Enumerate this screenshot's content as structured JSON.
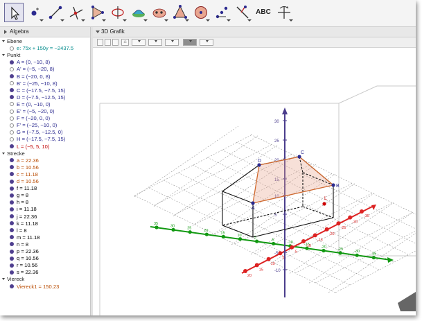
{
  "tools": [
    "move-tool",
    "point-tool",
    "segment-tool",
    "perpendicular-tool",
    "polygon-tool",
    "rotate-around-tool",
    "intersect-surfaces-tool",
    "pyramid-tool",
    "sphere-tool",
    "cube-tool",
    "reflect-tool",
    "line-tool",
    "text-tool",
    "rotate-view-tool"
  ],
  "text_tool_label": "ABC",
  "algebra": {
    "title": "Algebra",
    "categories": [
      "Ebene",
      "Punkt",
      "Strecke",
      "Viereck"
    ],
    "rows": [
      {
        "label": "e: 75x + 150y = −2437.5",
        "color": "#008b8b",
        "visible": false,
        "category_row": 0
      },
      {
        "label": "A = (0, −10, 8)",
        "color": "#2b2a8f",
        "visible": true
      },
      {
        "label": "A' = (−5, −20, 8)",
        "color": "#2b2a8f",
        "visible": false
      },
      {
        "label": "B = (−20, 0, 8)",
        "color": "#2b2a8f",
        "visible": true
      },
      {
        "label": "B' = (−25, −10, 8)",
        "color": "#2b2a8f",
        "visible": false
      },
      {
        "label": "C = (−17.5, −7.5, 15)",
        "color": "#2b2a8f",
        "visible": true
      },
      {
        "label": "D = (−7.5, −12.5, 15)",
        "color": "#2b2a8f",
        "visible": true
      },
      {
        "label": "E = (0, −10, 0)",
        "color": "#2b2a8f",
        "visible": false
      },
      {
        "label": "E' = (−5, −20, 0)",
        "color": "#2b2a8f",
        "visible": false
      },
      {
        "label": "F = (−20, 0, 0)",
        "color": "#2b2a8f",
        "visible": false
      },
      {
        "label": "F' = (−25, −10, 0)",
        "color": "#2b2a8f",
        "visible": false
      },
      {
        "label": "G = (−7.5, −12.5, 0)",
        "color": "#2b2a8f",
        "visible": false
      },
      {
        "label": "H = (−17.5, −7.5, 15)",
        "color": "#2b2a8f",
        "visible": false
      },
      {
        "label": "L = (−5, 5, 10)",
        "color": "#c00000",
        "visible": true
      },
      {
        "label": "a = 22.36",
        "color": "#b84a00",
        "visible": true
      },
      {
        "label": "b = 10.56",
        "color": "#b84a00",
        "visible": true
      },
      {
        "label": "c = 11.18",
        "color": "#b84a00",
        "visible": true
      },
      {
        "label": "d = 10.56",
        "color": "#b84a00",
        "visible": true
      },
      {
        "label": "f = 11.18",
        "color": "#000000",
        "visible": true
      },
      {
        "label": "g = 8",
        "color": "#000000",
        "visible": true
      },
      {
        "label": "h = 8",
        "color": "#000000",
        "visible": true
      },
      {
        "label": "i = 11.18",
        "color": "#000000",
        "visible": true
      },
      {
        "label": "j = 22.36",
        "color": "#000000",
        "visible": true
      },
      {
        "label": "k = 11.18",
        "color": "#000000",
        "visible": true
      },
      {
        "label": "l = 8",
        "color": "#000000",
        "visible": true
      },
      {
        "label": "m = 11.18",
        "color": "#000000",
        "visible": true
      },
      {
        "label": "n = 8",
        "color": "#000000",
        "visible": true
      },
      {
        "label": "p = 22.36",
        "color": "#000000",
        "visible": true
      },
      {
        "label": "q = 10.56",
        "color": "#000000",
        "visible": true
      },
      {
        "label": "r = 10.56",
        "color": "#000000",
        "visible": true
      },
      {
        "label": "s = 22.36",
        "color": "#000000",
        "visible": true
      },
      {
        "label": "Viereck1 = 150.23",
        "color": "#b84a00",
        "visible": true
      }
    ]
  },
  "graphics": {
    "title": "3D Grafik",
    "home_icon": "⌂",
    "point_labels": {
      "A": "A",
      "B": "B",
      "C": "C",
      "D": "D",
      "L": "L"
    },
    "z_ticks": [
      "30",
      "25",
      "20",
      "15",
      "10",
      "5",
      "-5",
      "-10"
    ],
    "x_ticks": [
      "35",
      "30",
      "25",
      "20",
      "15",
      "10",
      "5",
      "-5",
      "-10",
      "-15",
      "-20",
      "-25",
      "-30",
      "-35"
    ],
    "y_ticks": [
      "20",
      "15",
      "10",
      "5",
      "-5",
      "-10",
      "-15",
      "-20",
      "-25",
      "-30",
      "-35"
    ],
    "x_axis_color": "#dd2222",
    "y_axis_color": "#119911",
    "z_axis_color": "#4a3c8c"
  }
}
